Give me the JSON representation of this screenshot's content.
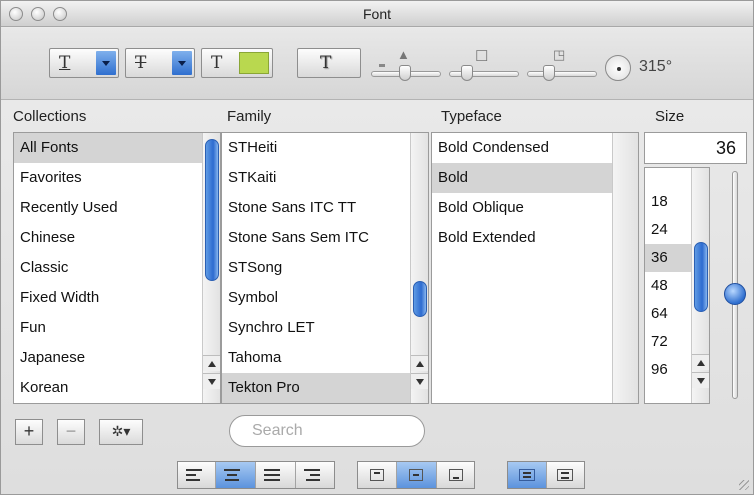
{
  "window": {
    "title": "Font"
  },
  "toolbar": {
    "underline_glyph": "T",
    "strike_glyph": "T",
    "color_glyph": "T",
    "shadow_glyph": "T",
    "colors": {
      "doc_color_swatch": "#b9d84f",
      "accent": "#2f6fcf"
    },
    "shadow_angle": "315°",
    "icons": [
      "underline-icon",
      "strikethrough-icon",
      "text-color-icon",
      "text-shadow-icon",
      "shadow-opacity-icon",
      "shadow-blur-icon",
      "shadow-offset-icon",
      "shadow-angle-icon"
    ]
  },
  "headers": {
    "collections": "Collections",
    "family": "Family",
    "typeface": "Typeface",
    "size": "Size"
  },
  "collections": [
    "All Fonts",
    "Favorites",
    "Recently Used",
    "Chinese",
    "Classic",
    "Fixed Width",
    "Fun",
    "Japanese",
    "Korean"
  ],
  "families": [
    "STHeiti",
    "STKaiti",
    "Stone Sans ITC TT",
    "Stone Sans Sem ITC",
    "STSong",
    "Symbol",
    "Synchro LET",
    "Tahoma",
    "Tekton Pro"
  ],
  "typefaces": [
    "Bold Condensed",
    "Bold",
    "Bold Oblique",
    "Bold Extended"
  ],
  "size": {
    "value": "36",
    "list": [
      "18",
      "24",
      "36",
      "48",
      "64",
      "72",
      "96"
    ]
  },
  "bottom": {
    "add_label": "+",
    "remove_label": "−",
    "action_label": "✲▾",
    "search_placeholder": "Search"
  }
}
